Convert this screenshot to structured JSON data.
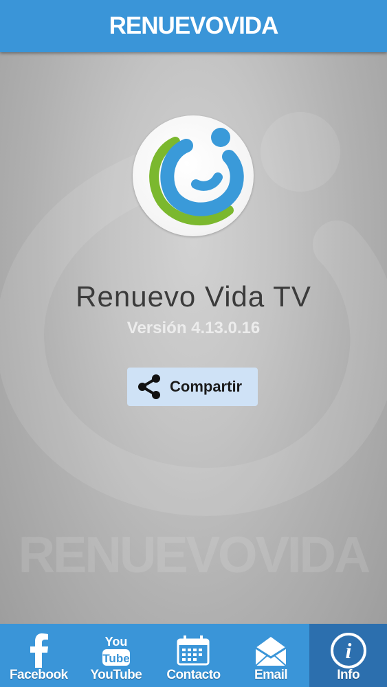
{
  "header": {
    "title": "RENUEVOVIDA"
  },
  "watermark": {
    "text": "RENUEVOVIDA"
  },
  "app": {
    "name": "Renuevo Vida TV",
    "version": "Versión 4.13.0.16"
  },
  "share": {
    "label": "Compartir",
    "icon": "share-icon"
  },
  "tabs": [
    {
      "label": "Facebook",
      "icon": "facebook-icon",
      "active": false
    },
    {
      "label": "YouTube",
      "icon": "youtube-icon",
      "active": false
    },
    {
      "label": "Contacto",
      "icon": "calendar-icon",
      "active": false
    },
    {
      "label": "Email",
      "icon": "envelope-icon",
      "active": false
    },
    {
      "label": "Info",
      "icon": "info-icon",
      "active": true
    }
  ],
  "colors": {
    "header": "#3a95d8",
    "tab_active": "#2c6fae",
    "logo_blue": "#3a9ad9",
    "logo_green": "#7bb82e"
  }
}
